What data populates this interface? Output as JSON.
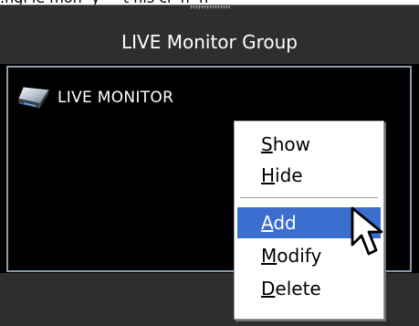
{
  "panel": {
    "title": "LIVE Monitor Group"
  },
  "monitor_list": {
    "items": [
      {
        "label": "LIVE MONITOR",
        "icon": "monitor-device-icon"
      }
    ]
  },
  "context_menu": {
    "items": [
      {
        "label_accel": "S",
        "label_rest": "how"
      },
      {
        "label_accel": "H",
        "label_rest": "ide"
      },
      {
        "label_accel": "A",
        "label_rest": "dd"
      },
      {
        "label_accel": "M",
        "label_rest": "odify"
      },
      {
        "label_accel": "D",
        "label_rest": "elete"
      }
    ],
    "selected": "Add"
  },
  "colors": {
    "panel_bg": "#000000",
    "header_bg": "#2e2e2e",
    "area_border": "#8a9aab",
    "menu_highlight": "#3b6ecf"
  }
}
